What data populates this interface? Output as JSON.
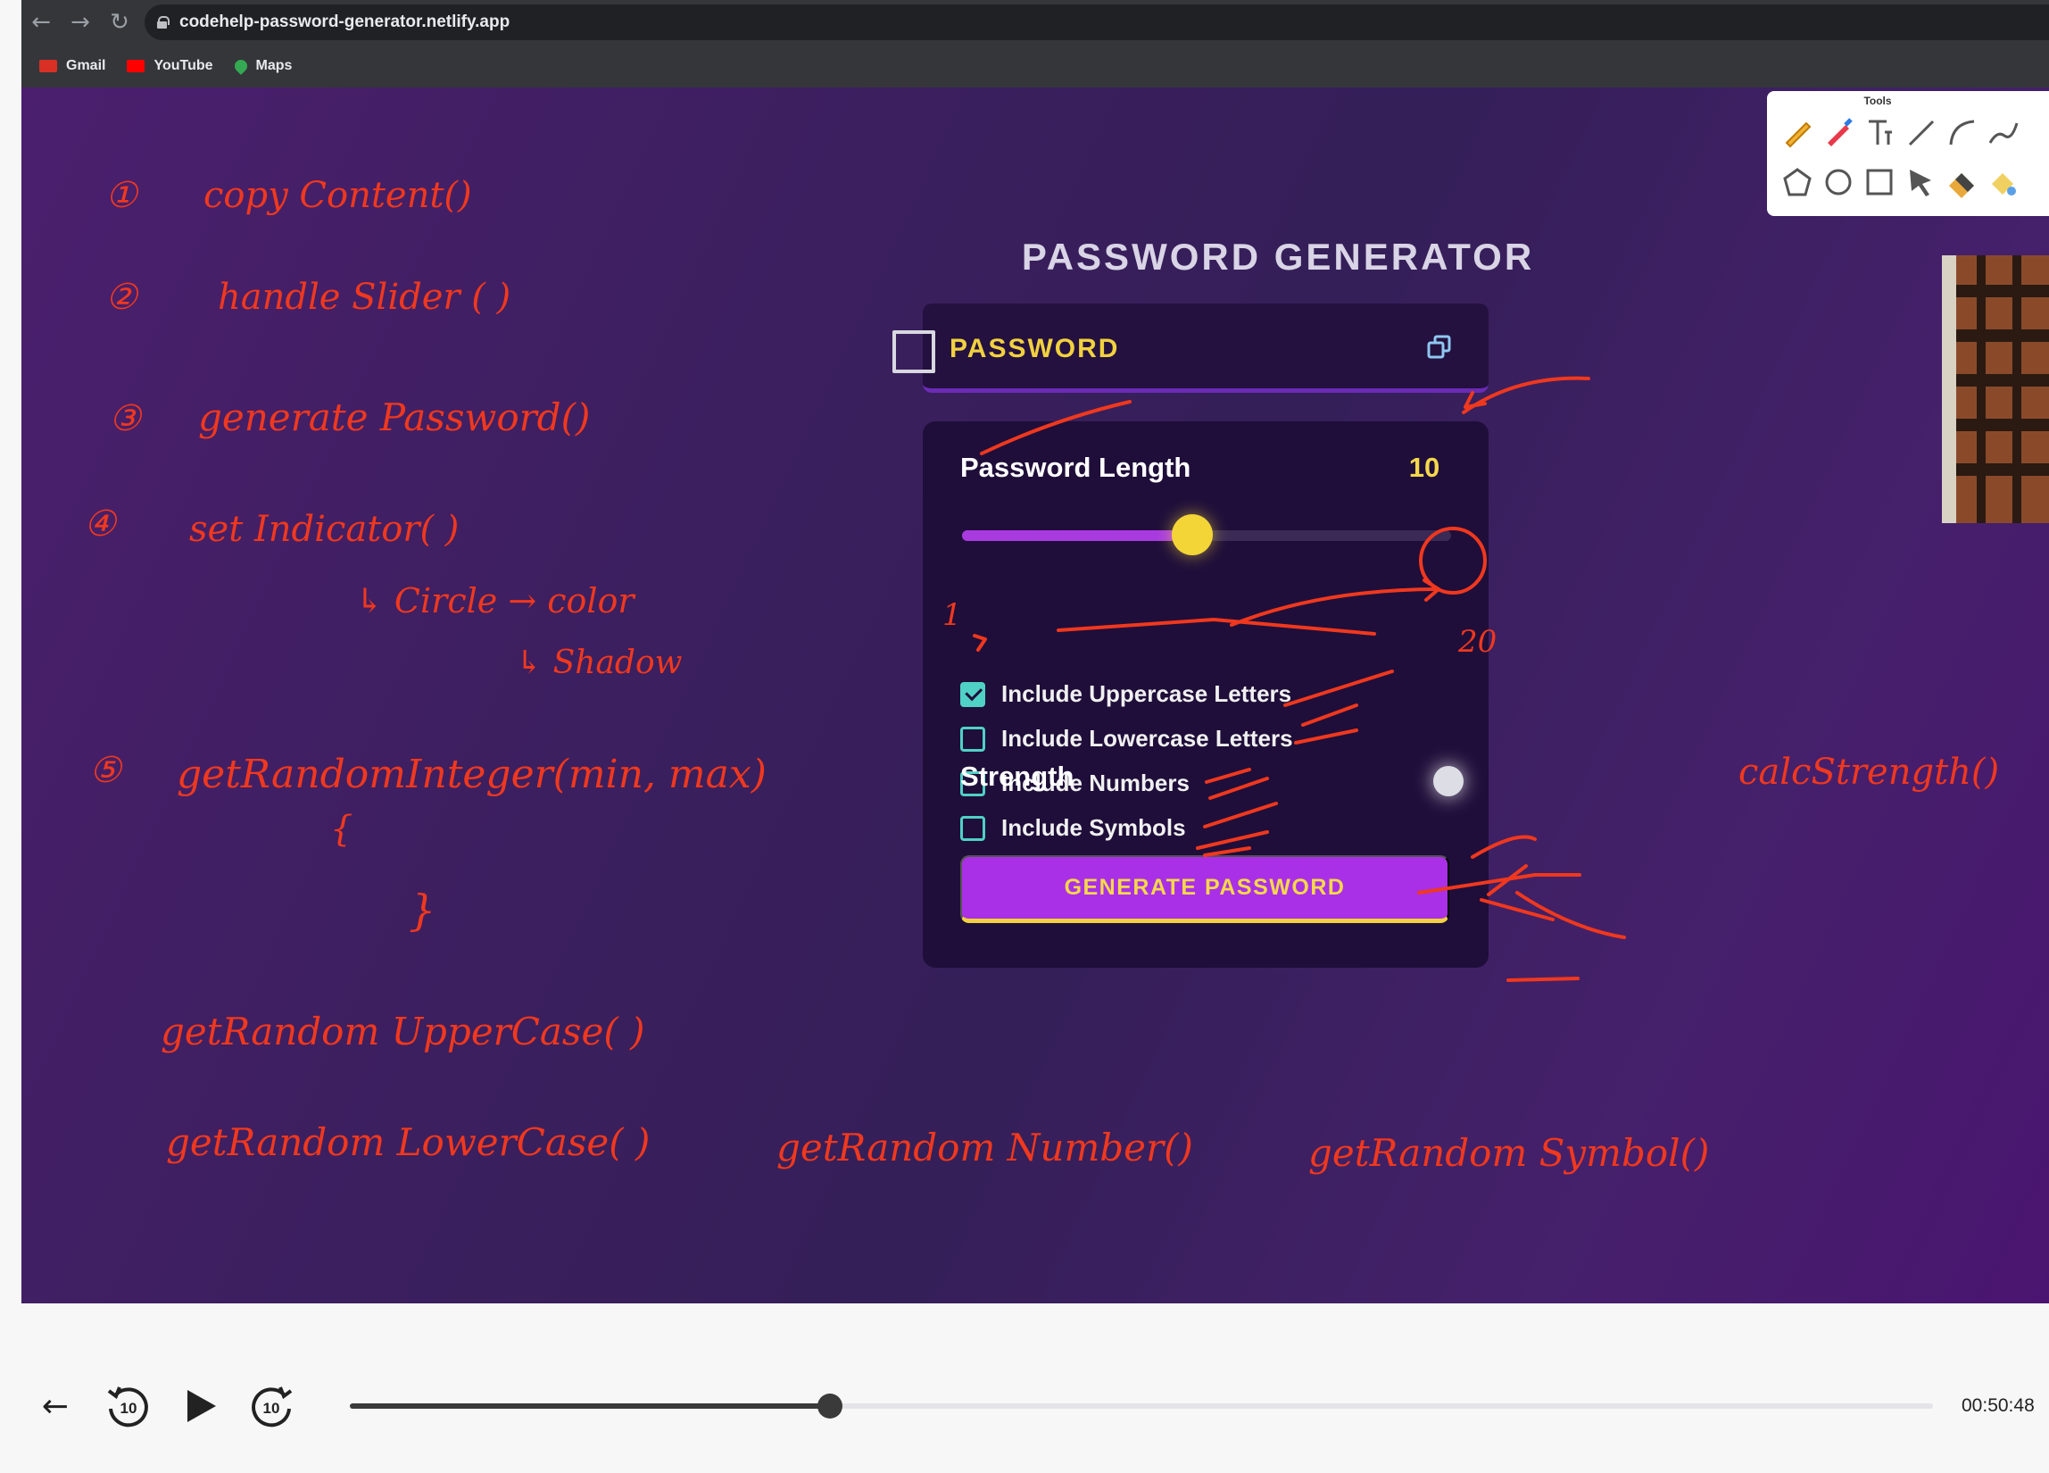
{
  "browser": {
    "url": "codehelp-password-generator.netlify.app",
    "bookmarks": [
      {
        "label": "Gmail",
        "color": "#d93025"
      },
      {
        "label": "YouTube",
        "color": "#ff0000"
      },
      {
        "label": "Maps",
        "color": "#34a853"
      }
    ]
  },
  "app": {
    "title": "PASSWORD GENERATOR",
    "password_placeholder": "PASSWORD",
    "length_label": "Password Length",
    "length_value": "10",
    "slider_fraction": 0.47,
    "options": [
      {
        "label": "Include Uppercase Letters",
        "checked": true
      },
      {
        "label": "Include Lowercase Letters",
        "checked": false
      },
      {
        "label": "Include Numbers",
        "checked": false
      },
      {
        "label": "Include Symbols",
        "checked": false
      }
    ],
    "strength_label": "Strength",
    "generate_label": "GENERATE PASSWORD",
    "colors": {
      "accent": "#a930e6",
      "highlight": "#f4d84b",
      "check": "#4fd1c5",
      "background": "#3d1f60"
    }
  },
  "tools": {
    "title": "Tools",
    "icons": [
      "pencil-icon",
      "highlighter-icon",
      "text-icon",
      "line-icon",
      "arc-icon",
      "curve-icon",
      "pentagon-icon",
      "circle-icon",
      "square-icon",
      "pointer-icon",
      "eraser-icon",
      "fill-icon"
    ]
  },
  "annotations": {
    "ink_color": "#f0381e",
    "notes": [
      {
        "label": "①",
        "text": "copy Content()"
      },
      {
        "label": "②",
        "text": "handle Slider ( )"
      },
      {
        "label": "③",
        "text": "generate Password()"
      },
      {
        "label": "④",
        "text": "set Indicator( )"
      },
      {
        "label": "",
        "text": "↳ Circle → color"
      },
      {
        "label": "",
        "text": "↳ Shadow"
      },
      {
        "label": "⑤",
        "text": "getRandomInteger(min, max)"
      },
      {
        "label": "",
        "text": "{"
      },
      {
        "label": "",
        "text": "}"
      },
      {
        "label": "",
        "text": "getRandom UpperCase( )"
      },
      {
        "label": "",
        "text": "getRandom LowerCase( )"
      },
      {
        "label": "",
        "text": "getRandom Number()"
      },
      {
        "label": "",
        "text": "getRandom Symbol()"
      },
      {
        "label": "",
        "text": "calcStrength()"
      }
    ],
    "slider_min": "1",
    "slider_max": "20"
  },
  "player": {
    "timecode": "00:50:48",
    "skip_back": "10",
    "skip_forward": "10",
    "progress_fraction": 0.303
  }
}
